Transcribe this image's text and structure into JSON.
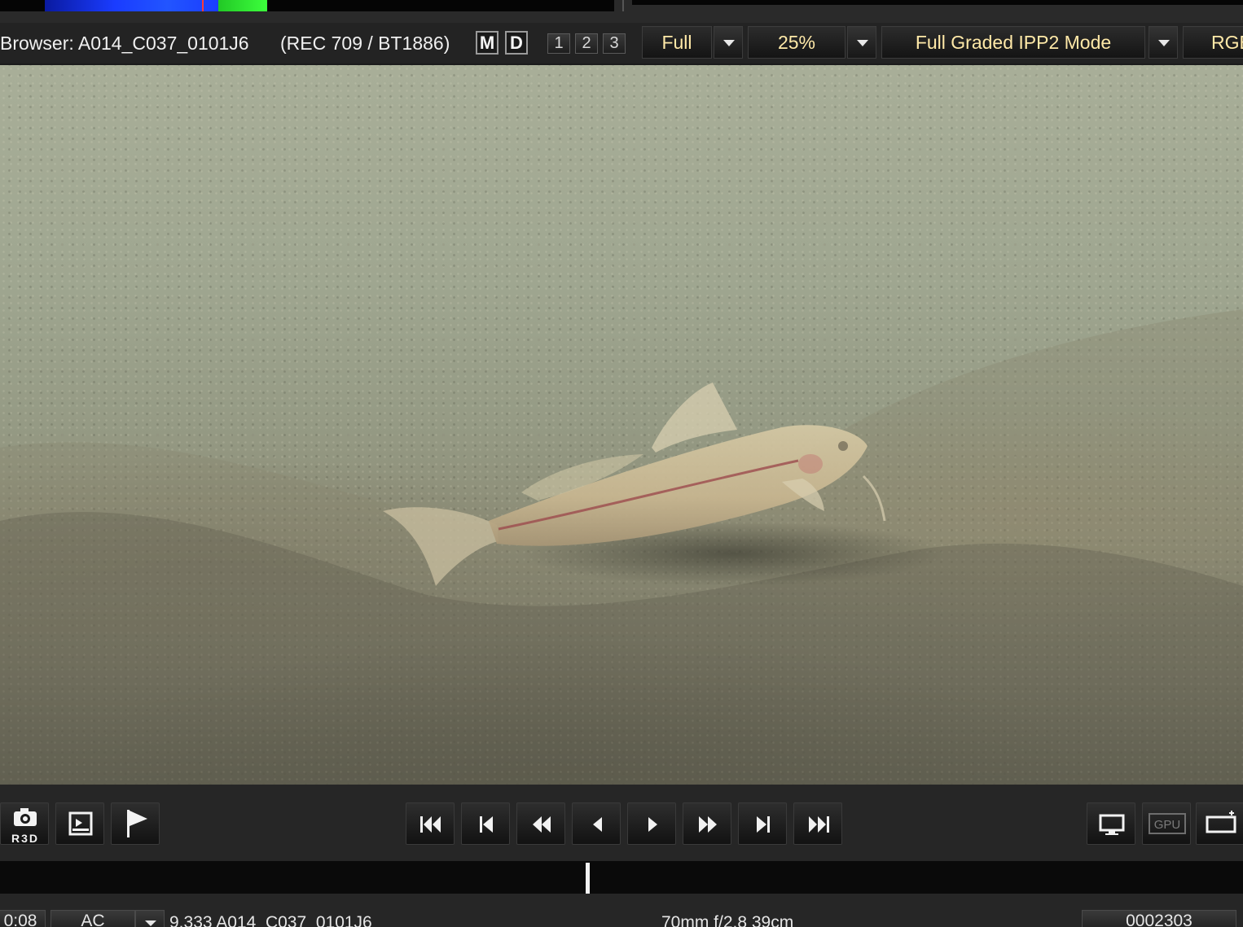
{
  "header": {
    "viewer_title": "Browser: A014_C037_0101J6",
    "color_space": "(REC 709 / BT1886)",
    "mode_buttons": [
      "M",
      "D"
    ],
    "view_buttons": [
      "1",
      "2",
      "3"
    ],
    "quality": "Full",
    "zoom": "25%",
    "decode_mode": "Full Graded IPP2 Mode",
    "channel": "RGB"
  },
  "transport": {
    "left_tools": [
      "r3d-snapshot-icon",
      "export-frame-icon",
      "marker-flag-icon"
    ],
    "r3d_label": "R3D",
    "playback": [
      "go-to-start-icon",
      "previous-clip-icon",
      "rewind-icon",
      "step-back-icon",
      "play-icon",
      "fast-forward-icon",
      "next-clip-icon",
      "go-to-end-icon"
    ],
    "right_tools": [
      "monitor-icon",
      "gpu-icon",
      "fit-window-icon"
    ],
    "gpu_label": "GPU"
  },
  "timeline": {
    "playhead_fraction": 0.473
  },
  "status": {
    "timecode": "0:08",
    "audio": "AC",
    "clip_info": "9.333 A014_C037_0101J6",
    "lens_info": "70mm  f/2.8  39cm",
    "frame": "0002303"
  }
}
